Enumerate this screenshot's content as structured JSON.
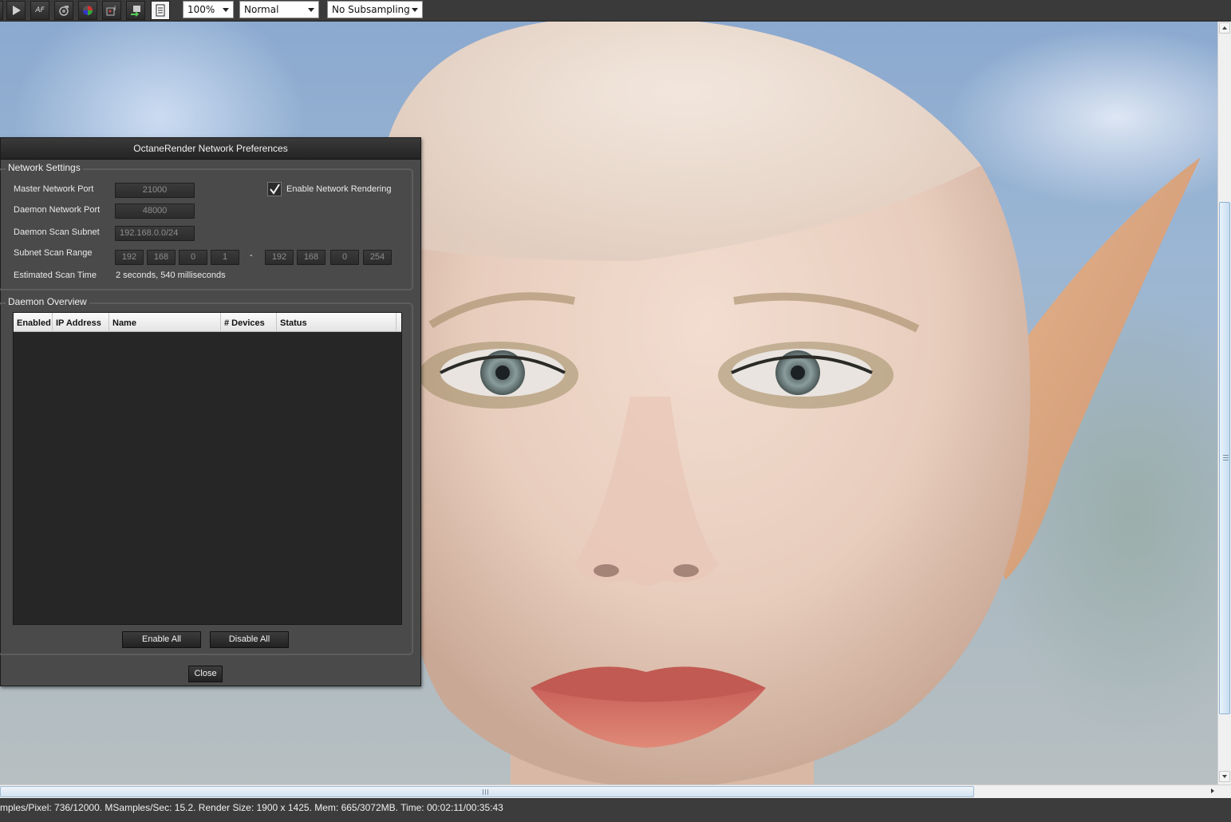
{
  "toolbar": {
    "buttons": [
      {
        "icon": "play-icon"
      },
      {
        "icon": "af-icon",
        "text": "AF"
      },
      {
        "icon": "camera-icon"
      },
      {
        "icon": "color-wheel-icon"
      },
      {
        "icon": "info-icon"
      },
      {
        "icon": "export-icon"
      },
      {
        "icon": "document-icon"
      }
    ],
    "zoom": "100%",
    "mode": "Normal",
    "subsampling": "No Subsampling"
  },
  "dialog": {
    "title": "OctaneRender Network Preferences",
    "network_settings": {
      "title": "Network Settings",
      "master_port_label": "Master Network Port",
      "master_port": "21000",
      "daemon_port_label": "Daemon Network Port",
      "daemon_port": "48000",
      "scan_subnet_label": "Daemon Scan Subnet",
      "scan_subnet": "192.168.0.0/24",
      "scan_range_label": "Subnet Scan Range",
      "range_start": [
        "192",
        "168",
        "0",
        "1"
      ],
      "range_separator": "-",
      "range_end": [
        "192",
        "168",
        "0",
        "254"
      ],
      "scan_time_label": "Estimated Scan Time",
      "scan_time": "2 seconds, 540 milliseconds",
      "enable_label": "Enable Network Rendering",
      "enable_checked": true
    },
    "daemon_overview": {
      "title": "Daemon Overview",
      "columns": [
        "Enabled",
        "IP Address",
        "Name",
        "# Devices",
        "Status"
      ],
      "rows": [],
      "enable_all": "Enable All",
      "disable_all": "Disable All"
    },
    "close": "Close"
  },
  "status": {
    "text": "mples/Pixel: 736/12000. MSamples/Sec: 15.2. Render Size: 1900 x 1425. Mem: 665/3072MB. Time: 00:02:11/00:35:43"
  }
}
